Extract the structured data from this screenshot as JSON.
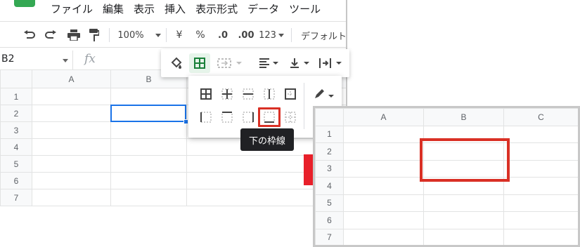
{
  "menu": [
    "ファイル",
    "編集",
    "表示",
    "挿入",
    "表示形式",
    "データ",
    "ツール"
  ],
  "toolbar": {
    "zoom": "100%",
    "currency": "¥",
    "percent": "%",
    "decimal_decrease": ".0",
    "decimal_increase": ".00",
    "more_formats": "123",
    "font": "デフォルト"
  },
  "name_box": "B2",
  "fx_label": "fx",
  "left_sheet": {
    "columns": [
      "A",
      "B",
      "C"
    ],
    "rows": [
      "1",
      "2",
      "3",
      "4",
      "5",
      "6",
      "7"
    ],
    "selected_cell": "B2"
  },
  "border_menu": {
    "tooltip": "下の枠線",
    "options": [
      "all-borders",
      "inner-borders",
      "horizontal-borders",
      "vertical-borders",
      "outer-borders",
      "left-border",
      "top-border",
      "right-border",
      "bottom-border",
      "clear-borders"
    ]
  },
  "right_sheet": {
    "columns": [
      "A",
      "B",
      "C"
    ],
    "rows": [
      "1",
      "2",
      "3",
      "4",
      "5",
      "6",
      "7"
    ]
  },
  "colors": {
    "selection": "#1a73e8",
    "highlight": "#d93025",
    "arrow": "#e8202a",
    "active_green": "#188038"
  }
}
